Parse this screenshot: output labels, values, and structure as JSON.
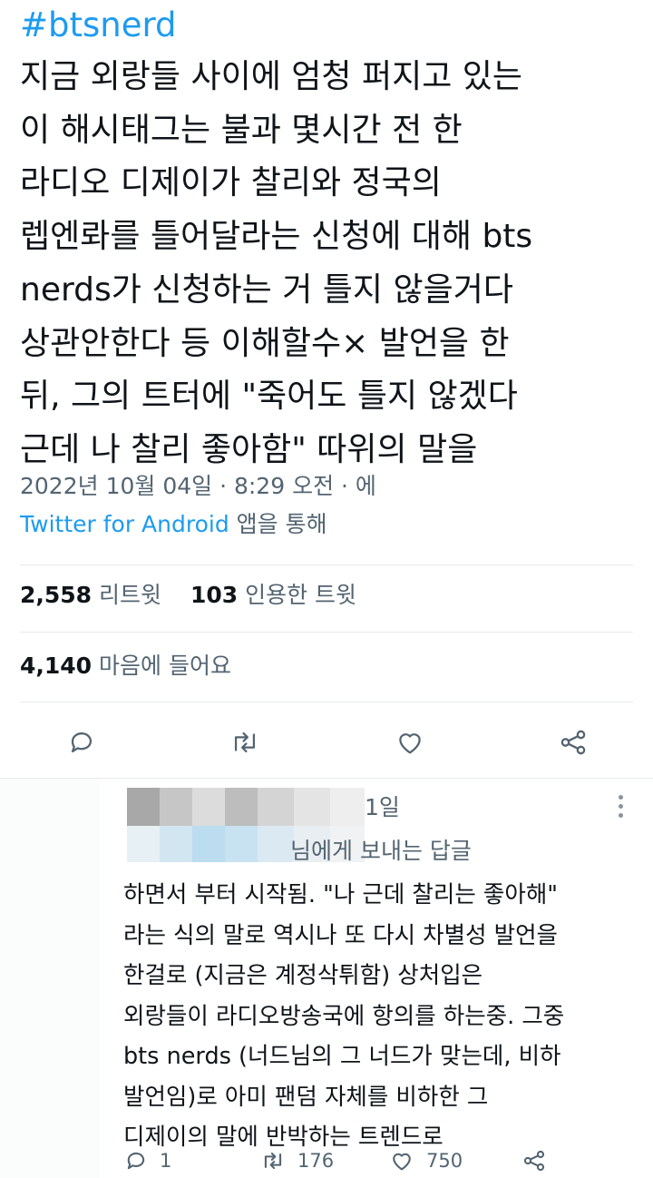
{
  "tweet": {
    "hashtag": "#btsnerd",
    "lines": [
      "지금 외랑들 사이에 엄청 퍼지고 있는",
      "이 해시태그는 불과 몇시간 전 한",
      "라디오 디제이가 찰리와 정국의",
      "렙엔롸를 틀어달라는 신청에 대해 bts",
      "nerds가 신청하는 거 틀지 않을거다",
      "상관안한다 등 이해할수× 발언을 한",
      "뒤, 그의 트터에 \"죽어도 틀지 않겠다",
      "근데 나 찰리 좋아함\" 따위의 말을"
    ],
    "timestamp": "2022년 10월 04일 · 8:29 오전 · 에",
    "source_app": "Twitter for Android",
    "source_suffix": " 앱을 통해"
  },
  "stats": {
    "retweets_count": "2,558",
    "retweets_label": " 리트윗",
    "quotes_count": "103",
    "quotes_label": " 인용한 트윗",
    "likes_count": "4,140",
    "likes_label": " 마음에 들어요"
  },
  "action_bar": {
    "icons": [
      "reply-icon",
      "retweet-icon",
      "like-icon",
      "share-icon"
    ]
  },
  "reply": {
    "header_visible_suffix": "1일",
    "reply_to_visible": "님에게 보내는 답글",
    "lines": [
      "하면서 부터 시작됨. \"나 근데 찰리는 좋아해\"",
      "라는 식의 말로 역시나 또 다시 차별성 발언을",
      "한걸로 (지금은 계정삭튀함) 상처입은",
      "외랑들이 라디오방송국에 항의를 하는중. 그중",
      "bts nerds (너드님의 그 너드가 맞는데, 비하",
      "발언임)로 아미 팬덤 자체를 비하한 그",
      "디제이의 말에 반박하는 트렌드로"
    ],
    "reply_count": "1",
    "retweet_count": "176",
    "like_count": "750"
  },
  "colors": {
    "accent": "#1d9bf0",
    "text": "#0f1419",
    "secondary": "#536471",
    "divider": "#e6e9ec"
  }
}
